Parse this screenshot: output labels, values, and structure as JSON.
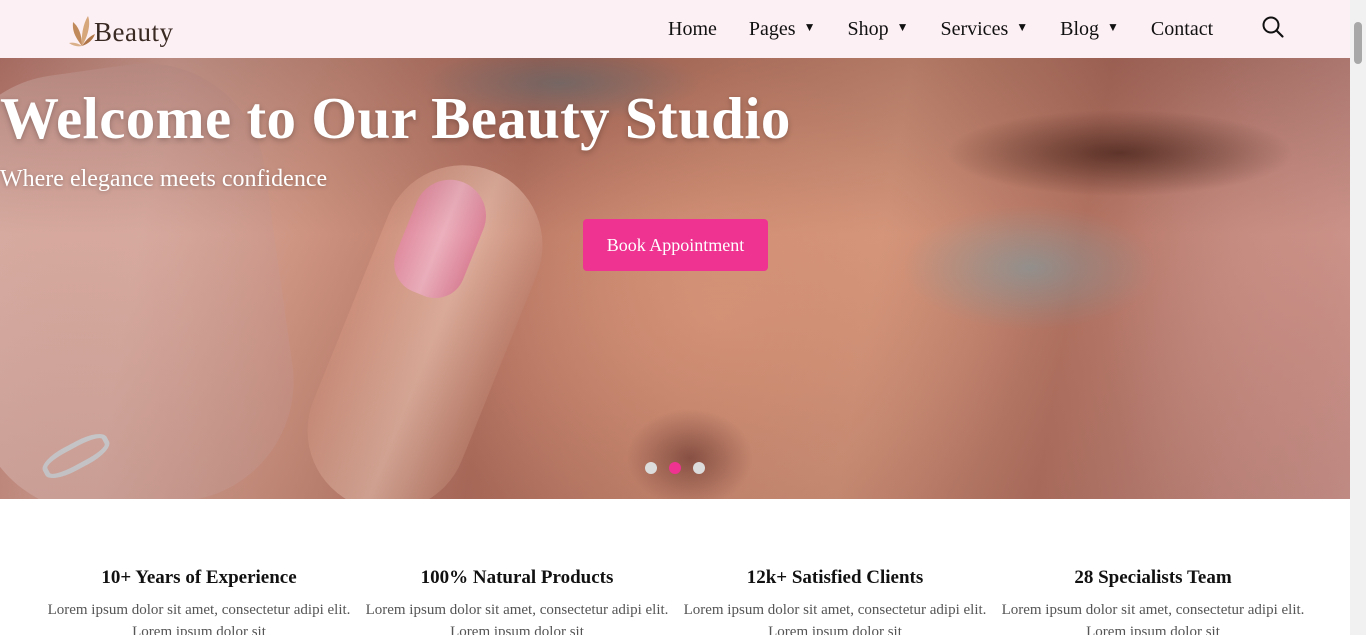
{
  "header": {
    "logo_text": "Beauty",
    "nav": [
      {
        "label": "Home",
        "has_caret": false
      },
      {
        "label": "Pages",
        "has_caret": true
      },
      {
        "label": "Shop",
        "has_caret": true
      },
      {
        "label": "Services",
        "has_caret": true
      },
      {
        "label": "Blog",
        "has_caret": true
      },
      {
        "label": "Contact",
        "has_caret": false
      }
    ],
    "caret_glyph": "▼",
    "search_icon": "search-icon"
  },
  "hero": {
    "title": "Welcome to Our Beauty Studio",
    "subtitle": "Where elegance meets confidence",
    "cta_label": "Book Appointment",
    "slides_count": 3,
    "active_slide": 2
  },
  "features": [
    {
      "title": "10+ Years of Experience",
      "text": "Lorem ipsum dolor sit amet, consectetur adipi elit. Lorem ipsum dolor sit"
    },
    {
      "title": "100% Natural Products",
      "text": "Lorem ipsum dolor sit amet, consectetur adipi elit. Lorem ipsum dolor sit"
    },
    {
      "title": "12k+ Satisfied Clients",
      "text": "Lorem ipsum dolor sit amet, consectetur adipi elit. Lorem ipsum dolor sit"
    },
    {
      "title": "28 Specialists Team",
      "text": "Lorem ipsum dolor sit amet, consectetur adipi elit. Lorem ipsum dolor sit"
    }
  ],
  "colors": {
    "accent": "#ee3391",
    "header_bg": "#fdf0f4",
    "logo_leaf": "#c08a5a"
  }
}
